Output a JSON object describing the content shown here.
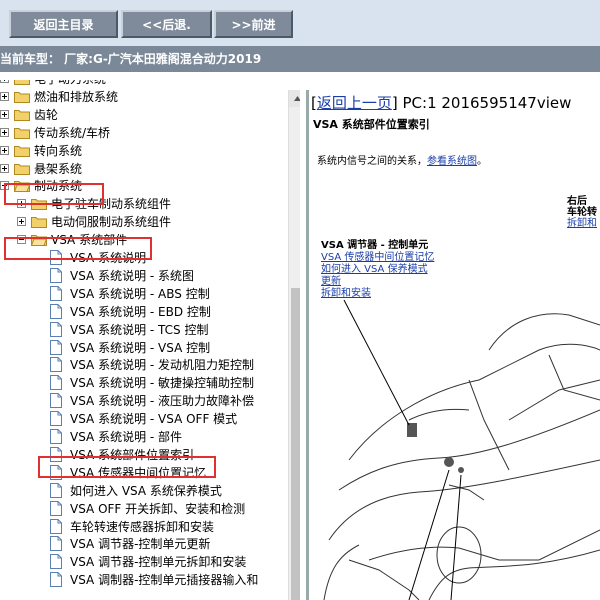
{
  "toolbar": {
    "home_label": "返回主目录",
    "back_label": "<<后退.",
    "forward_label": ">>前进"
  },
  "vehicle_bar": {
    "text": "当前车型： 厂家:G-广汽本田雅阁混合动力2019"
  },
  "tree": {
    "items": [
      {
        "label": "电子动力系统"
      },
      {
        "label": "燃油和排放系统"
      },
      {
        "label": "齿轮"
      },
      {
        "label": "传动系统/车桥"
      },
      {
        "label": "转向系统"
      },
      {
        "label": "悬架系统"
      },
      {
        "label": "制动系统"
      },
      {
        "label": "电子驻车制动系统组件"
      },
      {
        "label": "电动伺服制动系统组件"
      },
      {
        "label": "VSA 系统部件"
      },
      {
        "label": "VSA 系统说明"
      },
      {
        "label": "VSA 系统说明 - 系统图"
      },
      {
        "label": "VSA 系统说明 - ABS 控制"
      },
      {
        "label": "VSA 系统说明 - EBD 控制"
      },
      {
        "label": "VSA 系统说明 - TCS 控制"
      },
      {
        "label": "VSA 系统说明 - VSA 控制"
      },
      {
        "label": "VSA 系统说明 - 发动机阻力矩控制"
      },
      {
        "label": "VSA 系统说明 - 敏捷操控辅助控制"
      },
      {
        "label": "VSA 系统说明 - 液压助力故障补偿"
      },
      {
        "label": "VSA 系统说明 - VSA OFF 模式"
      },
      {
        "label": "VSA 系统说明 - 部件"
      },
      {
        "label": "VSA 系统部件位置索引"
      },
      {
        "label": "VSA 传感器中间位置记忆"
      },
      {
        "label": "如何进入 VSA 系统保养模式"
      },
      {
        "label": "VSA OFF 开关拆卸、安装和检测"
      },
      {
        "label": "车轮转速传感器拆卸和安装"
      },
      {
        "label": "VSA 调节器-控制单元更新"
      },
      {
        "label": "VSA 调节器-控制单元拆卸和安装"
      },
      {
        "label": "VSA 调制器-控制单元插接器输入和"
      }
    ]
  },
  "content": {
    "back_link": "返回上一页",
    "page_info": "PC:1 2016595147view",
    "title": "VSA 系统部件位置索引",
    "intro_text": "系统内信号之间的关系，",
    "intro_link": "参看系统图",
    "intro_end": "。",
    "callout": {
      "title": "VSA 调节器 - 控制单元",
      "links": [
        "VSA 传感器中间位置记忆",
        "如何进入 VSA 保养模式",
        "更新",
        "拆卸和安装"
      ]
    },
    "side_callout": {
      "line1": "右后",
      "line2": "车轮转",
      "link": "拆卸和"
    }
  }
}
